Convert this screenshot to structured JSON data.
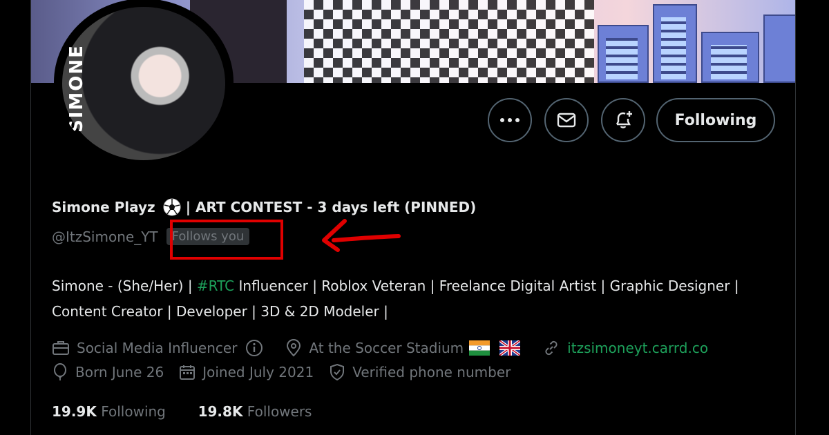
{
  "profile": {
    "display_name": "Simone Playz",
    "name_suffix": "| ART CONTEST - 3 days left (PINNED)",
    "handle": "@ItzSimone_YT",
    "follows_badge": "Follows you",
    "avatar_text": "SIMONE"
  },
  "actions": {
    "more_label": "···",
    "following_label": "Following"
  },
  "bio": {
    "part1": "Simone - (She/Her) | ",
    "hashtag": "#RTC",
    "part2": " Influencer | Roblox Veteran | Freelance Digital Artist | Graphic Designer | Content Creator | Developer | 3D & 2D Modeler |"
  },
  "meta": {
    "category": "Social Media Influencer",
    "location": "At the Soccer Stadium",
    "website": "itzsimoneyt.carrd.co",
    "birthday": "Born June 26",
    "joined": "Joined July 2021",
    "verified": "Verified phone number"
  },
  "stats": {
    "following_count": "19.9K",
    "following_label": "Following",
    "followers_count": "19.8K",
    "followers_label": "Followers"
  },
  "annotation": {
    "highlight_color": "#e00000"
  },
  "colors": {
    "background": "#000000",
    "text": "#e7e9ea",
    "muted": "#71767b",
    "link": "#1da05a"
  }
}
